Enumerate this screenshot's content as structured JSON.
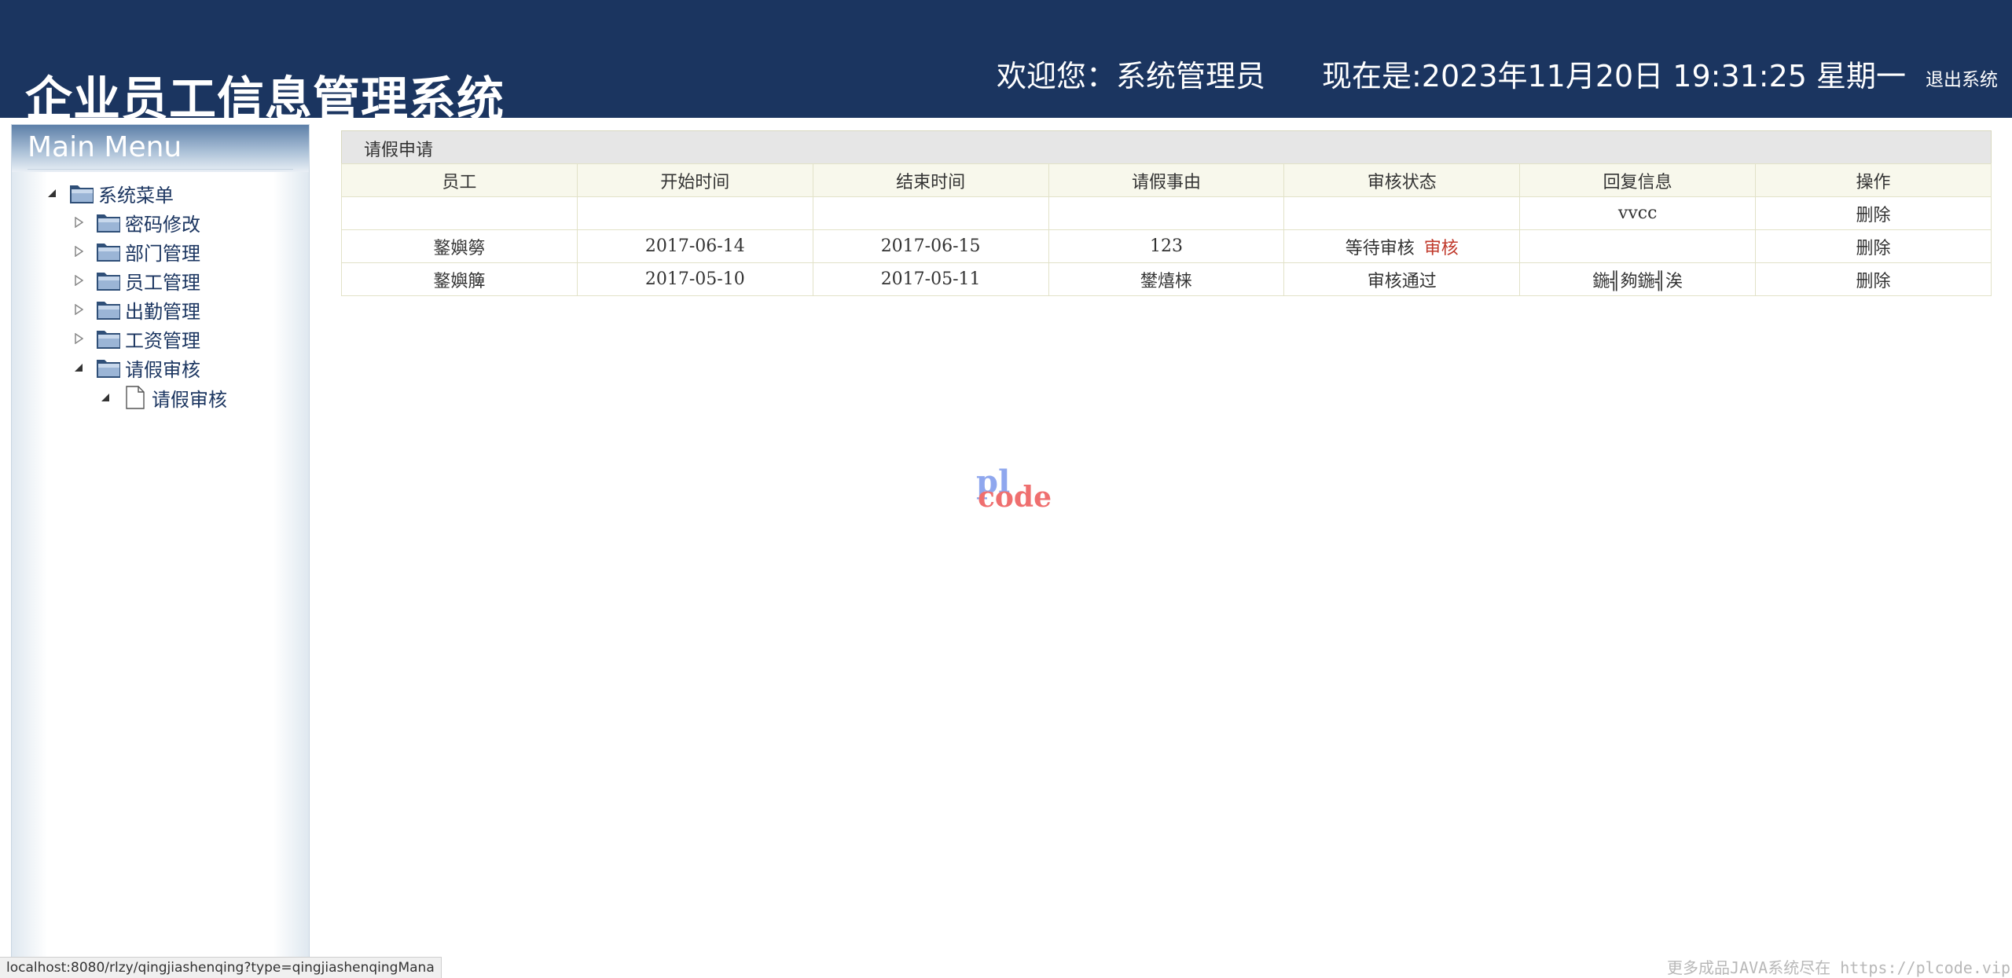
{
  "header": {
    "title": "企业员工信息管理系统",
    "welcome": "欢迎您：系统管理员",
    "clock": "现在是:2023年11月20日 19:31:25 星期一",
    "logout_label": "退出系统"
  },
  "sidebar": {
    "title": "Main Menu",
    "root": {
      "label": "系统菜单",
      "icon": "folder-open-icon",
      "expanded": true
    },
    "items": [
      {
        "label": "密码修改",
        "icon": "folder-icon",
        "expanded": false
      },
      {
        "label": "部门管理",
        "icon": "folder-icon",
        "expanded": false
      },
      {
        "label": "员工管理",
        "icon": "folder-icon",
        "expanded": false
      },
      {
        "label": "出勤管理",
        "icon": "folder-icon",
        "expanded": false
      },
      {
        "label": "工资管理",
        "icon": "folder-icon",
        "expanded": false
      },
      {
        "label": "请假审核",
        "icon": "folder-icon",
        "expanded": true
      }
    ],
    "subitems": [
      {
        "label": "请假审核",
        "icon": "document-icon"
      }
    ]
  },
  "panel": {
    "title": "请假申请",
    "columns": [
      "员工",
      "开始时间",
      "结束时间",
      "请假事由",
      "审核状态",
      "回复信息",
      "操作"
    ],
    "rows": [
      {
        "employee": "",
        "start": "",
        "end": "",
        "reason": "",
        "status": "",
        "audit_link": "",
        "reply": "vvcc",
        "action": "删除"
      },
      {
        "employee": "鐜嬩簩",
        "start": "2017-06-14",
        "end": "2017-06-15",
        "reason": "123",
        "status": "等待审核",
        "audit_link": "审核",
        "reply": "",
        "action": "删除"
      },
      {
        "employee": "鐜嬩簲",
        "start": "2017-05-10",
        "end": "2017-05-11",
        "reason": "鐢熺梾",
        "status": "审核通过",
        "audit_link": "",
        "reply": "鍦╣夠鍦╣涘",
        "action": "删除"
      }
    ]
  },
  "watermark": {
    "line1": "pl",
    "line2": "code"
  },
  "status_url": "localhost:8080/rlzy/qingjiashenqing?type=qingjiashenqingMana",
  "footer_note": "更多成品JAVA系统尽在 https://plcode.vip",
  "colors": {
    "header_bg": "#1b3560",
    "table_header_bg": "#f8f8ec",
    "audit_link": "#c0392b",
    "tree_label": "#1b3560"
  }
}
